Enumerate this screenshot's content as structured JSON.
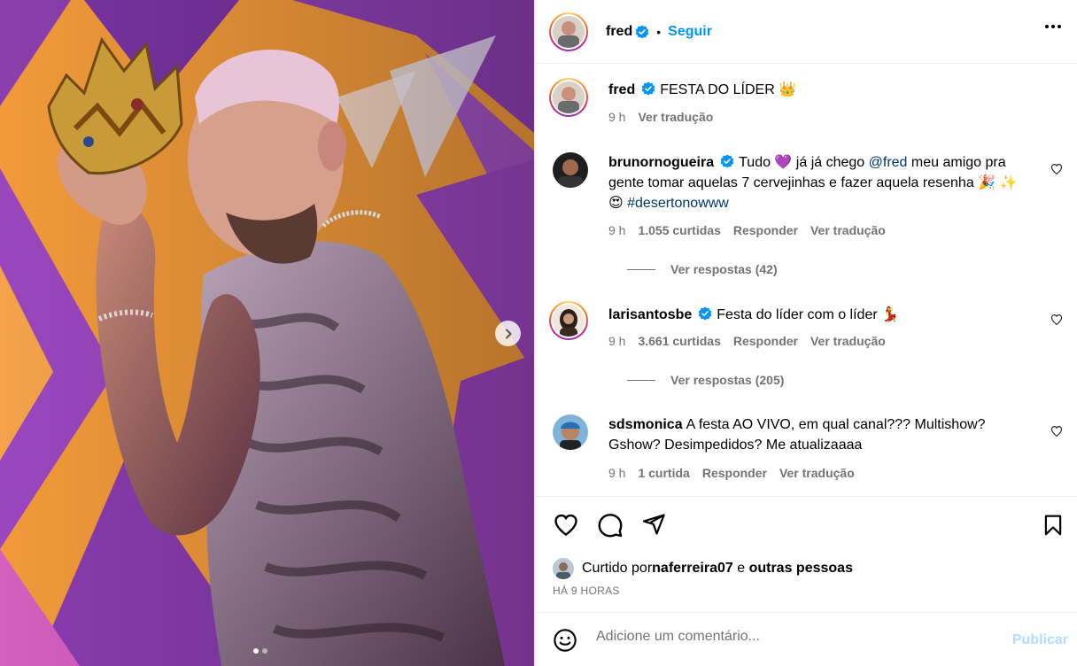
{
  "post": {
    "author": "fred",
    "follow_label": "Seguir",
    "dot": "•",
    "more_icon": "more-horizontal-icon"
  },
  "caption": {
    "username": "fred",
    "text": "FESTA DO LÍDER",
    "emoji": "👑",
    "time": "9 h",
    "translate": "Ver tradução"
  },
  "comments": [
    {
      "username": "brunornogueira",
      "verified": true,
      "text_1": "Tudo 💜  já já chego ",
      "mention": "@fred",
      "text_2": " meu amigo pra gente tomar aquelas 7 cervejinhas e fazer aquela resenha 🎉 ✨ 😍 ",
      "hashtag": "#desertonowww",
      "time": "9 h",
      "likes": "1.055 curtidas",
      "reply": "Responder",
      "translate": "Ver tradução",
      "view_replies": "Ver respostas (42)"
    },
    {
      "username": "larisantosbe",
      "verified": true,
      "text_1": "Festa do líder com o líder 💃",
      "time": "9 h",
      "likes": "3.661 curtidas",
      "reply": "Responder",
      "translate": "Ver tradução",
      "view_replies": "Ver respostas (205)"
    },
    {
      "username": "sdsmonica",
      "verified": false,
      "text_1": "A festa AO VIVO, em qual canal??? Multishow? Gshow? Desimpedidos? Me atualizaaaa",
      "time": "9 h",
      "likes": "1 curtida",
      "reply": "Responder",
      "translate": "Ver tradução"
    }
  ],
  "likes_line": {
    "prefix": "Curtido por ",
    "user": "naferreira07",
    "middle": " e ",
    "others": "outras pessoas"
  },
  "timestamp": "HÁ 9 HORAS",
  "add_comment": {
    "placeholder": "Adicione um comentário...",
    "publish": "Publicar"
  },
  "media": {
    "carousel_index": 1,
    "carousel_total": 2
  },
  "colors": {
    "accent": "#0095f6",
    "verified": "#0095f6",
    "link": "#00376b",
    "muted": "#737373",
    "publish_disabled": "#b3dbff"
  }
}
